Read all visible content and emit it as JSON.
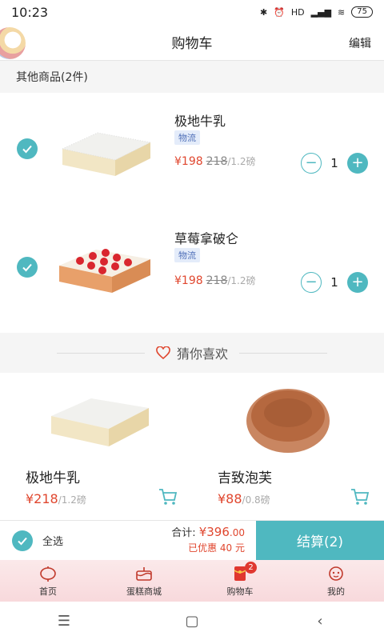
{
  "status": {
    "time": "10:23",
    "battery": "75",
    "network": "HD"
  },
  "header": {
    "title": "购物车",
    "edit_label": "编辑"
  },
  "section": {
    "title": "其他商品(2件)"
  },
  "items": [
    {
      "name": "极地牛乳",
      "tag": "物流",
      "price": "¥198",
      "orig_price": "218",
      "unit": "/1.2磅",
      "qty": "1"
    },
    {
      "name": "草莓拿破仑",
      "tag": "物流",
      "price": "¥198",
      "orig_price": "218",
      "unit": "/1.2磅",
      "qty": "1"
    }
  ],
  "recommend": {
    "title": "猜你喜欢",
    "products": [
      {
        "name": "极地牛乳",
        "price": "¥218",
        "unit": "/1.2磅"
      },
      {
        "name": "吉致泡芙",
        "price": "¥88",
        "unit": "/0.8磅"
      }
    ]
  },
  "checkout": {
    "select_all": "全选",
    "total_label": "合计:",
    "total_main": "¥396",
    "total_cents": ".00",
    "discount": "已优惠 40 元",
    "button": "结算(2)"
  },
  "tabs": [
    {
      "label": "首页",
      "icon": "lantern-icon"
    },
    {
      "label": "蛋糕商城",
      "icon": "cake-icon"
    },
    {
      "label": "购物车",
      "icon": "red-envelope-icon",
      "badge": "2"
    },
    {
      "label": "我的",
      "icon": "flower-icon"
    }
  ],
  "colors": {
    "accent": "#4fb8c0",
    "price": "#e0472f",
    "tab_bg": "#f8d9dc"
  }
}
